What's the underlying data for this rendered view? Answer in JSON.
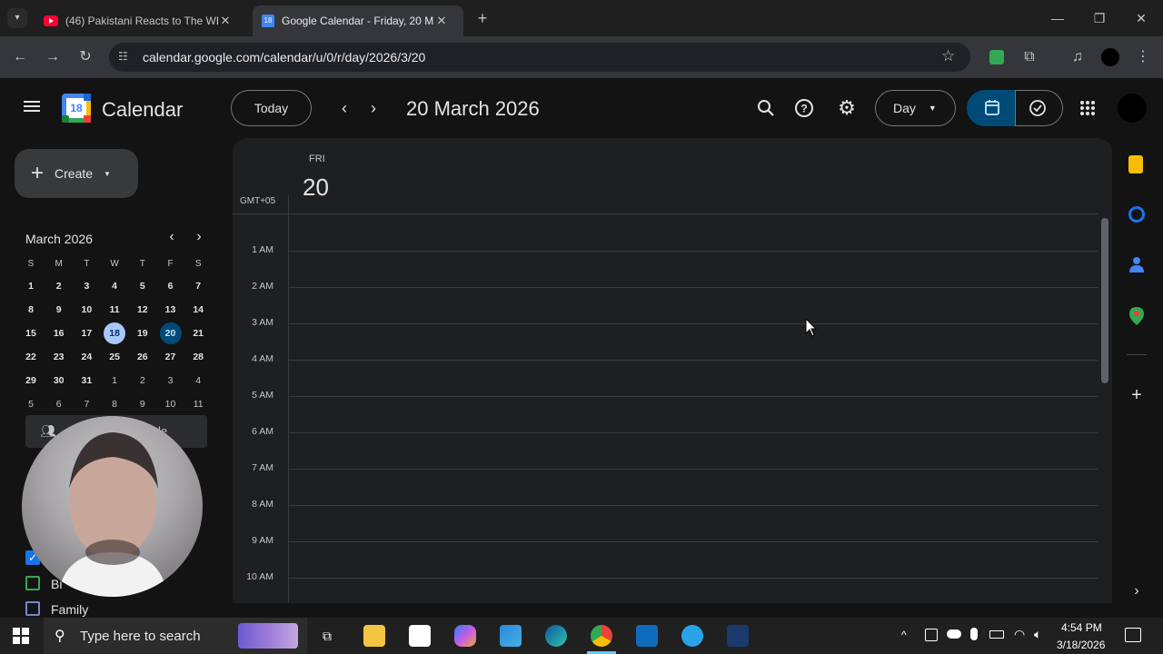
{
  "browser": {
    "tabs": [
      {
        "title": "(46) Pakistani Reacts to The WE",
        "active": false
      },
      {
        "title": "Google Calendar - Friday, 20 M",
        "active": true
      }
    ],
    "url": "calendar.google.com/calendar/u/0/r/day/2026/3/20"
  },
  "header": {
    "app_name": "Calendar",
    "logo_day": "18",
    "today_label": "Today",
    "date_title": "20 March 2026",
    "view_label": "Day"
  },
  "sidebar": {
    "create_label": "Create",
    "mini_calendar": {
      "month_label": "March 2026",
      "weekdays": [
        "S",
        "M",
        "T",
        "W",
        "T",
        "F",
        "S"
      ],
      "weeks": [
        [
          "1",
          "2",
          "3",
          "4",
          "5",
          "6",
          "7"
        ],
        [
          "8",
          "9",
          "10",
          "11",
          "12",
          "13",
          "14"
        ],
        [
          "15",
          "16",
          "17",
          "18",
          "19",
          "20",
          "21"
        ],
        [
          "22",
          "23",
          "24",
          "25",
          "26",
          "27",
          "28"
        ],
        [
          "29",
          "30",
          "31",
          "1",
          "2",
          "3",
          "4"
        ],
        [
          "5",
          "6",
          "7",
          "8",
          "9",
          "10",
          "11"
        ]
      ],
      "today": "18",
      "selected": "20"
    },
    "search_people_partial": "le",
    "calendars": [
      {
        "label": "Bi",
        "checked": true
      },
      {
        "label": "Family",
        "checked": false
      }
    ]
  },
  "dayview": {
    "weekday": "FRI",
    "day_number": "20",
    "timezone": "GMT+05",
    "hours": [
      "1 AM",
      "2 AM",
      "3 AM",
      "4 AM",
      "5 AM",
      "6 AM",
      "7 AM",
      "8 AM",
      "9 AM",
      "10 AM"
    ]
  },
  "taskbar": {
    "search_placeholder": "Type here to search",
    "time": "4:54 PM",
    "date": "3/18/2026"
  },
  "colors": {
    "accent_blue": "#a8c7fa",
    "selected_day": "#004a77",
    "active_view": "#004a77"
  }
}
